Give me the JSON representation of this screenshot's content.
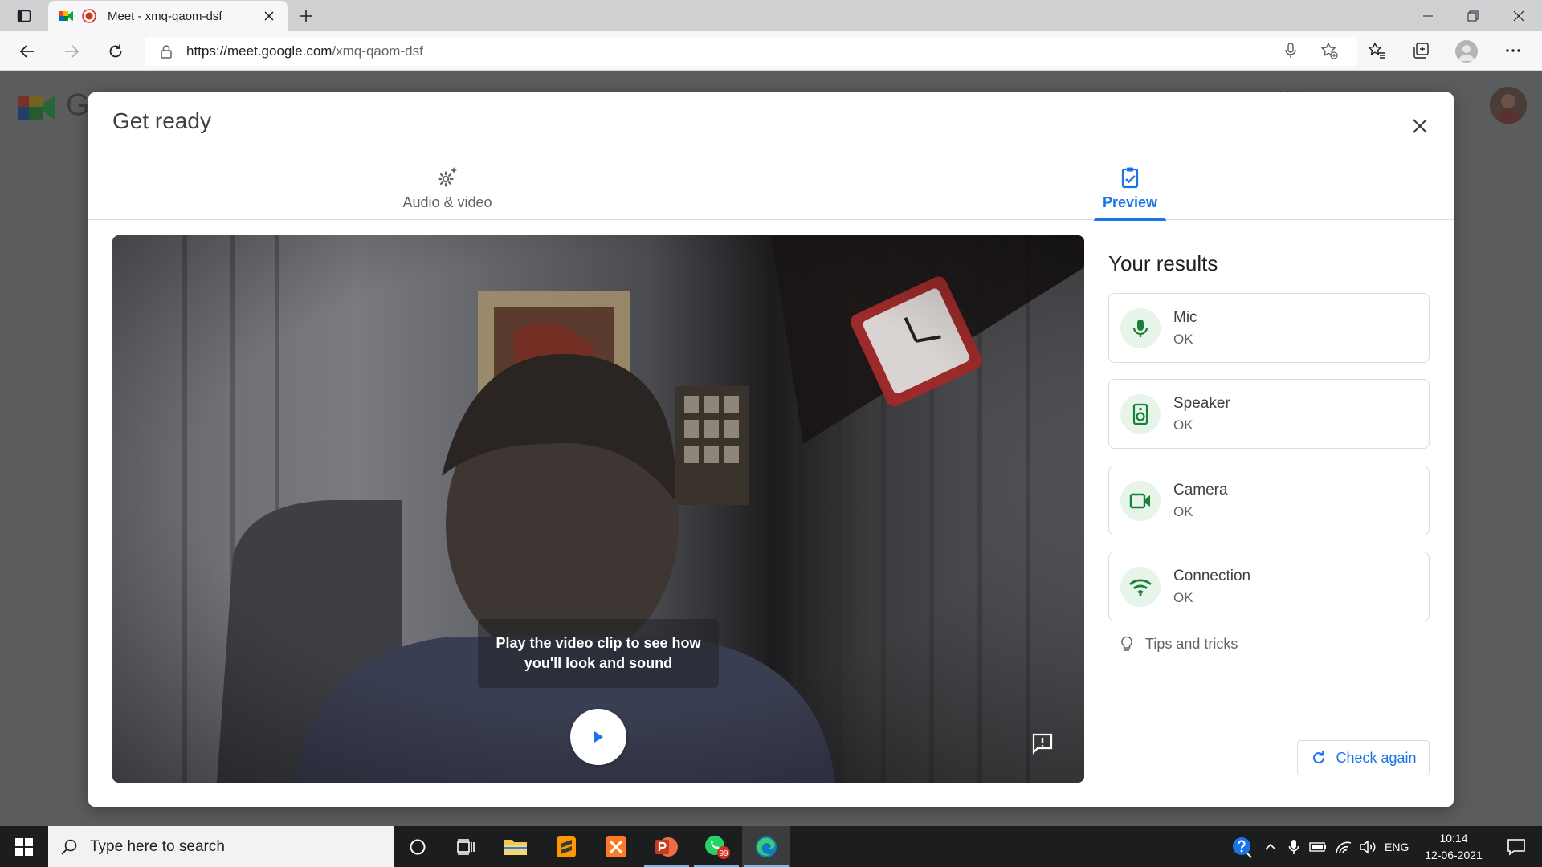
{
  "browser": {
    "tab_title": "Meet - xmq-qaom-dsf",
    "url_host": "https://meet.google.com",
    "url_path": "/xmq-qaom-dsf"
  },
  "background_page": {
    "logo_letter": "G",
    "account_line1": "com",
    "account_line2": "ount"
  },
  "dialog": {
    "title": "Get ready",
    "tabs": [
      {
        "label": "Audio & video",
        "icon": "settings-sparkle-icon",
        "active": false
      },
      {
        "label": "Preview",
        "icon": "clipboard-check-icon",
        "active": true
      }
    ],
    "video": {
      "message": "Play the video clip to see how you'll look and sound"
    },
    "results": {
      "title": "Your results",
      "items": [
        {
          "name": "Mic",
          "status": "OK",
          "icon": "mic-icon"
        },
        {
          "name": "Speaker",
          "status": "OK",
          "icon": "speaker-icon"
        },
        {
          "name": "Camera",
          "status": "OK",
          "icon": "camera-icon"
        },
        {
          "name": "Connection",
          "status": "OK",
          "icon": "wifi-icon"
        }
      ],
      "tips_label": "Tips and tricks",
      "check_again_label": "Check again"
    }
  },
  "taskbar": {
    "search_placeholder": "Type here to search",
    "whatsapp_badge": "99",
    "language": "ENG",
    "time": "10:14",
    "date": "12-06-2021"
  },
  "colors": {
    "accent": "#1a73e8",
    "ok_green": "#188038",
    "ok_bg": "#e6f4ea"
  }
}
